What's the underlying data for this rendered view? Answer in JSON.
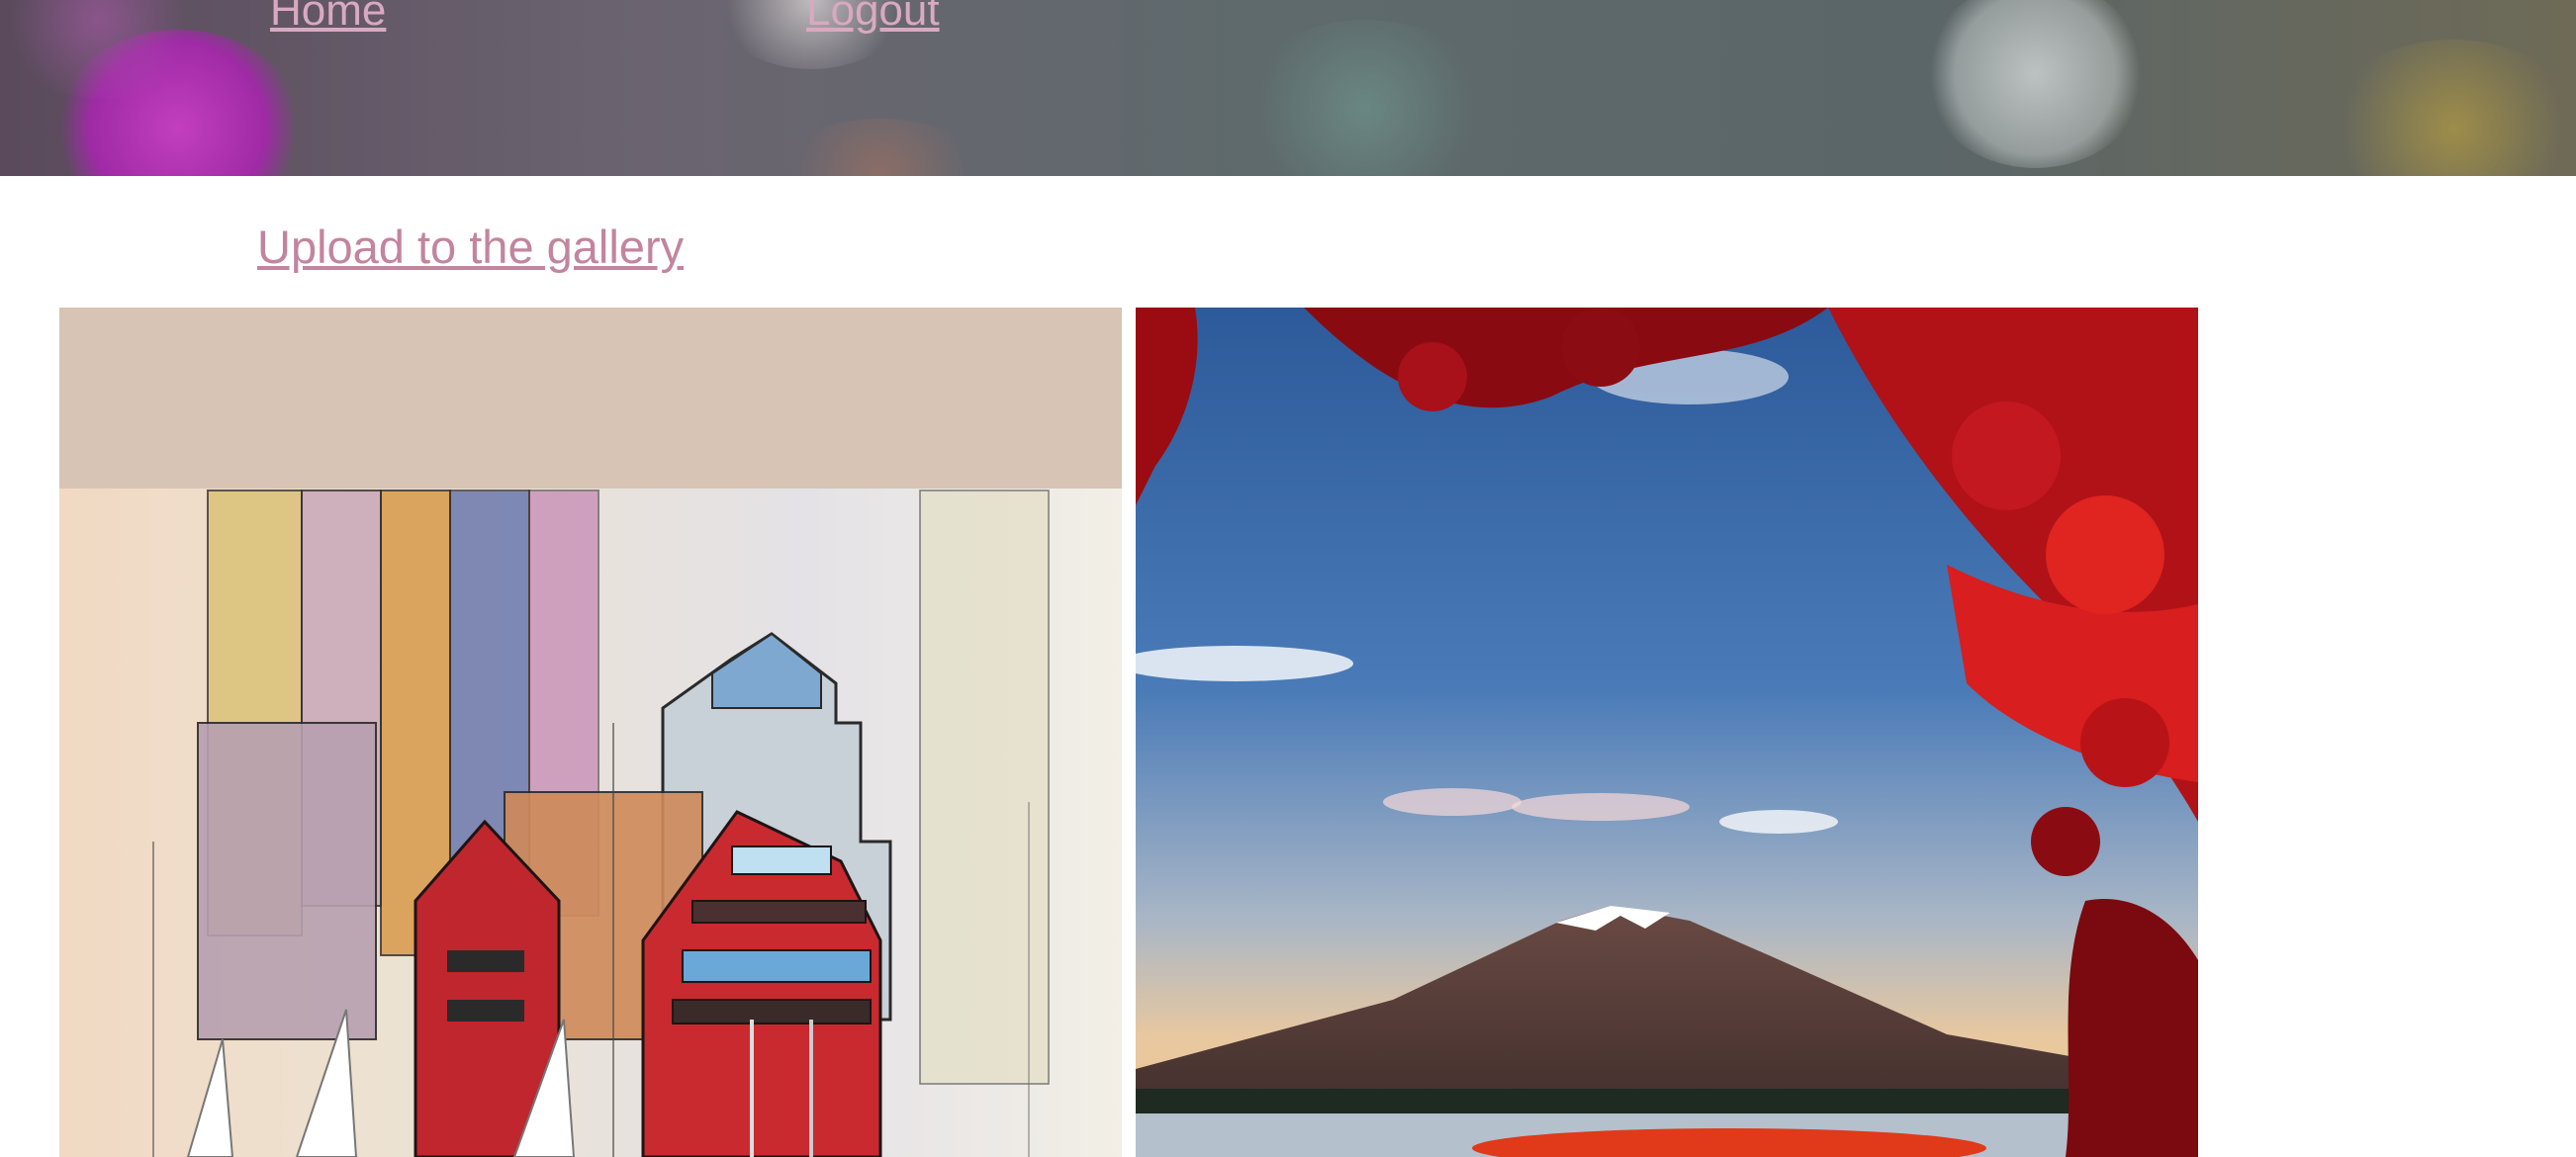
{
  "nav": {
    "home_label": "Home",
    "logout_label": "Logout"
  },
  "actions": {
    "upload_label": "Upload to the gallery"
  },
  "gallery": {
    "items": [
      {
        "subject": "watercolor-city-harbor-painting"
      },
      {
        "subject": "mountain-fuji-with-red-maple-leaves-photo"
      }
    ]
  },
  "colors": {
    "nav_link": "#d9a9c0",
    "upload_link": "#c3849e",
    "tile_background": "#d8c4b4"
  }
}
